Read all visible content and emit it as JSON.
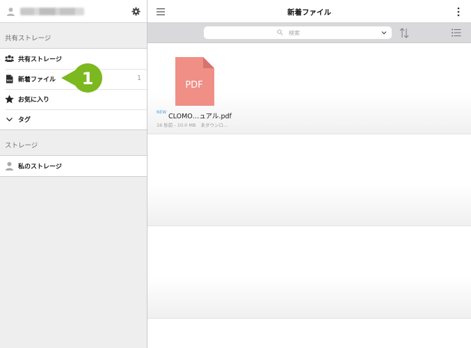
{
  "sidebar": {
    "section_shared": "共有ストレージ",
    "items_shared": [
      {
        "label": "共有ストレージ",
        "icon": "users-icon"
      },
      {
        "label": "新着ファイル",
        "icon": "new-file-icon",
        "count": "1"
      },
      {
        "label": "お気に入り",
        "icon": "star-icon"
      },
      {
        "label": "タグ",
        "icon": "chevron-down-icon"
      }
    ],
    "section_storage": "ストレージ",
    "items_storage": [
      {
        "label": "私のストレージ",
        "icon": "user-icon"
      }
    ],
    "callout_number": "1"
  },
  "header": {
    "title": "新着ファイル"
  },
  "search": {
    "placeholder": "検索"
  },
  "files": [
    {
      "badge": "NEW",
      "name": "CLOMO…ュアル.pdf",
      "thumb_label": "PDF",
      "modified": "16 秒前 - 10.0 MB",
      "status": "未ダウンロ…"
    }
  ],
  "colors": {
    "accent_green": "#7cb81f",
    "pdf_pink": "#f08f86",
    "new_badge": "#4aa3df"
  }
}
